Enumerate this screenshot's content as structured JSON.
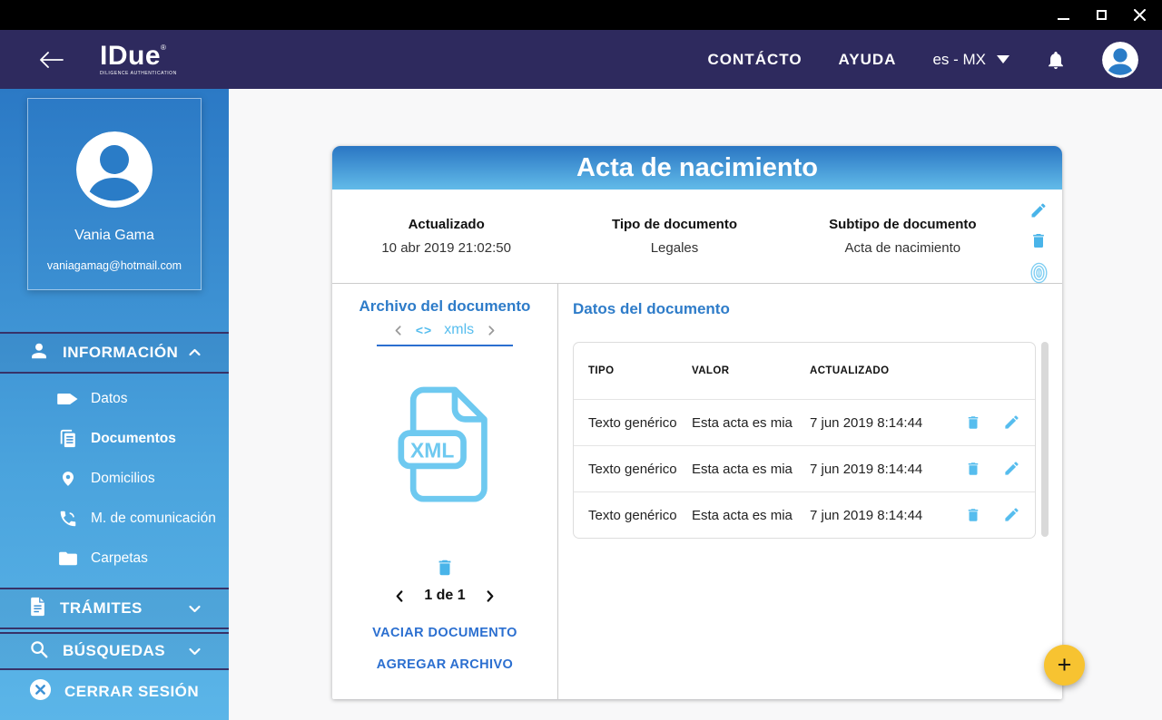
{
  "titlebar": {
    "controls": [
      "minimize-icon",
      "maximize-icon",
      "close-icon"
    ]
  },
  "header": {
    "logo": {
      "title": "IDue",
      "registered": "®",
      "subtitle": "DILIGENCE AUTHENTICATION"
    },
    "nav_contact": "CONTÁCTO",
    "nav_help": "AYUDA",
    "language": "es - MX"
  },
  "sidebar": {
    "profile": {
      "name": "Vania Gama",
      "email": "vaniagamag@hotmail.com"
    },
    "sections": [
      {
        "label": "INFORMACIÓN",
        "icon": "user-icon",
        "state": "expanded",
        "items": [
          {
            "label": "Datos",
            "icon": "tag-icon",
            "active": false
          },
          {
            "label": "Documentos",
            "icon": "documents-icon",
            "active": true
          },
          {
            "label": "Domicilios",
            "icon": "location-pin-icon",
            "active": false
          },
          {
            "label": "M. de comunicación",
            "icon": "phone-icon",
            "active": false
          },
          {
            "label": "Carpetas",
            "icon": "folder-icon",
            "active": false
          }
        ]
      },
      {
        "label": "TRÁMITES",
        "icon": "document-icon",
        "state": "collapsed"
      },
      {
        "label": "BÚSQUEDAS",
        "icon": "search-icon",
        "state": "collapsed"
      }
    ],
    "logout_label": "CERRAR SESIÓN"
  },
  "document_card": {
    "title": "Acta de nacimiento",
    "meta": [
      {
        "label": "Actualizado",
        "value": "10 abr 2019 21:02:50"
      },
      {
        "label": "Tipo de documento",
        "value": "Legales"
      },
      {
        "label": "Subtipo de documento",
        "value": "Acta de nacimiento"
      }
    ],
    "header_actions": [
      "edit-icon",
      "trash-icon",
      "fingerprint-icon"
    ],
    "file_panel": {
      "title": "Archivo del documento",
      "code_glyph": "<>",
      "active_tab": "xmls",
      "file_type": "XML",
      "pagination": "1 de 1",
      "clear_action": "VACIAR DOCUMENTO",
      "add_action": "AGREGAR ARCHIVO"
    },
    "data_panel": {
      "title": "Datos del documento",
      "columns": [
        "TIPO",
        "VALOR",
        "ACTUALIZADO"
      ],
      "rows": [
        {
          "tipo": "Texto genérico",
          "valor": "Esta acta es mia",
          "actualizado": "7 jun 2019 8:14:44"
        },
        {
          "tipo": "Texto genérico",
          "valor": "Esta acta es mia",
          "actualizado": "7 jun 2019 8:14:44"
        },
        {
          "tipo": "Texto genérico",
          "valor": "Esta acta es mia",
          "actualizado": "7 jun 2019 8:14:44"
        }
      ]
    }
  },
  "fab": {
    "label": "+"
  },
  "colors": {
    "header_navy": "#2e2a5e",
    "sidebar_top": "#2b79c5",
    "sidebar_bottom": "#5bb5e8",
    "card_header_top": "#2a76c3",
    "card_header_bottom": "#62bbe9",
    "accent_blue": "#2e7cc9",
    "light_blue_icon": "#56bdee",
    "link_blue": "#2b6fd0",
    "fab_yellow": "#f7c331"
  }
}
